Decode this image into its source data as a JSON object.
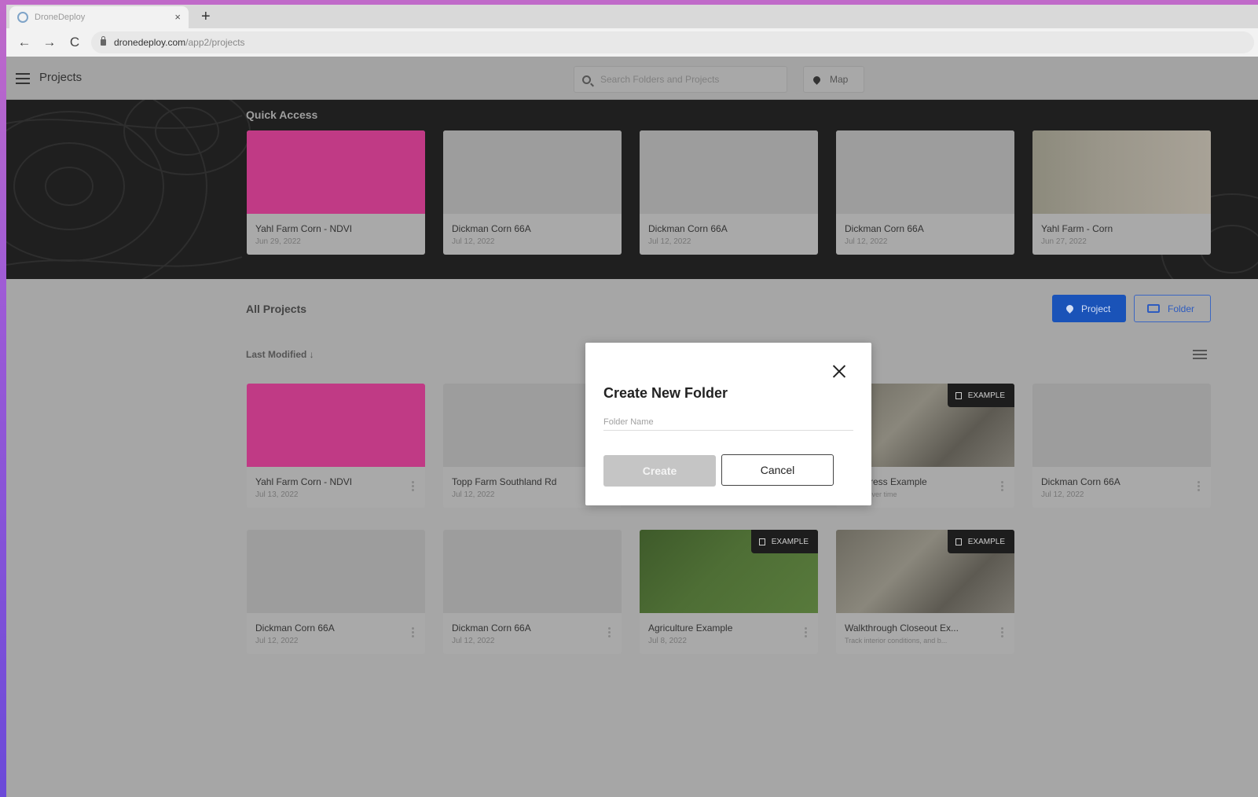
{
  "browser": {
    "tab_title": "DroneDeploy",
    "new_tab": "+",
    "close_tab": "×",
    "url_host": "dronedeploy.com",
    "url_path": "/app2/projects",
    "back": "←",
    "forward": "→",
    "reload": "C"
  },
  "header": {
    "title": "Projects",
    "search_placeholder": "Search Folders and Projects",
    "map_label": "Map"
  },
  "quick_access": {
    "title": "Quick Access",
    "items": [
      {
        "title": "Yahl Farm Corn - NDVI",
        "date": "Jun 29, 2022",
        "thumb": "pink-ndvi"
      },
      {
        "title": "Dickman Corn 66A",
        "date": "Jul 12, 2022",
        "thumb": "topo-placeholder"
      },
      {
        "title": "Dickman Corn 66A",
        "date": "Jul 12, 2022",
        "thumb": "topo-placeholder"
      },
      {
        "title": "Dickman Corn 66A",
        "date": "Jul 12, 2022",
        "thumb": "topo-placeholder"
      },
      {
        "title": "Yahl Farm - Corn",
        "date": "Jun 27, 2022",
        "thumb": "field-aerial"
      }
    ]
  },
  "all_projects": {
    "title": "All Projects",
    "sort_label": "Last Modified ↓",
    "project_button": "Project",
    "folder_button": "Folder",
    "example_badge": "EXAMPLE",
    "items": [
      {
        "title": "Yahl Farm Corn - NDVI",
        "date": "Jul 13, 2022"
      },
      {
        "title": "Topp Farm Southland Rd",
        "date": "Jul 12, 2022"
      },
      {
        "title": "t Progress Example",
        "date": "ogress over time"
      },
      {
        "title": "Dickman Corn 66A",
        "date": "Jul 12, 2022"
      },
      {
        "title": "Dickman Corn 66A",
        "date": "Jul 12, 2022"
      },
      {
        "title": "Dickman Corn 66A",
        "date": "Jul 12, 2022"
      },
      {
        "title": "Agriculture Example",
        "date": "Jul 8, 2022"
      },
      {
        "title": "Walkthrough Closeout Ex...",
        "date": "Track interior conditions, and b..."
      }
    ]
  },
  "modal": {
    "title": "Create New Folder",
    "input_placeholder": "Folder Name",
    "input_value": "",
    "create_label": "Create",
    "cancel_label": "Cancel"
  },
  "colors": {
    "brand_blue": "#1a53b8",
    "ndvi_pink": "#c03a85",
    "band_dark": "#1f1f1f"
  }
}
